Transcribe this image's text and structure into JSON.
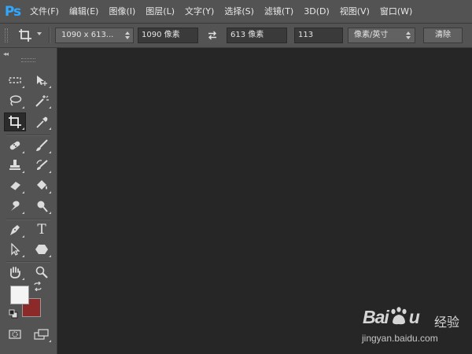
{
  "app": {
    "logo": "Ps"
  },
  "menu": [
    "文件(F)",
    "编辑(E)",
    "图像(I)",
    "图层(L)",
    "文字(Y)",
    "选择(S)",
    "滤镜(T)",
    "3D(D)",
    "视图(V)",
    "窗口(W)"
  ],
  "options": {
    "tool_icon": "crop-icon",
    "preset": "1090 x 613...",
    "width": "1090 像素",
    "height": "613 像素",
    "resolution": "113",
    "unit": "像素/英寸",
    "clear": "清除"
  },
  "toolbox": {
    "collapse": "◂◂",
    "tools": [
      "rectangular-marquee-icon",
      "move-icon",
      "lasso-icon",
      "magic-wand-icon",
      "crop-icon",
      "eyedropper-icon",
      "spot-healing-brush-icon",
      "brush-icon",
      "clone-stamp-icon",
      "history-brush-icon",
      "eraser-icon",
      "paint-bucket-icon",
      "smudge-icon",
      "dodge-icon",
      "pen-icon",
      "type-icon",
      "path-selection-icon",
      "shape-icon",
      "hand-icon",
      "zoom-icon",
      "quick-mask-icon",
      "screen-mode-icon"
    ],
    "active_tool": "crop-icon",
    "type_tool_glyph": "T",
    "foreground_color": "#f4f4f4",
    "background_color": "#8c2a2a"
  },
  "watermark": {
    "brand": "Bai",
    "brand_suffix": "u",
    "label": "经验",
    "url": "jingyan.baidu.com"
  }
}
